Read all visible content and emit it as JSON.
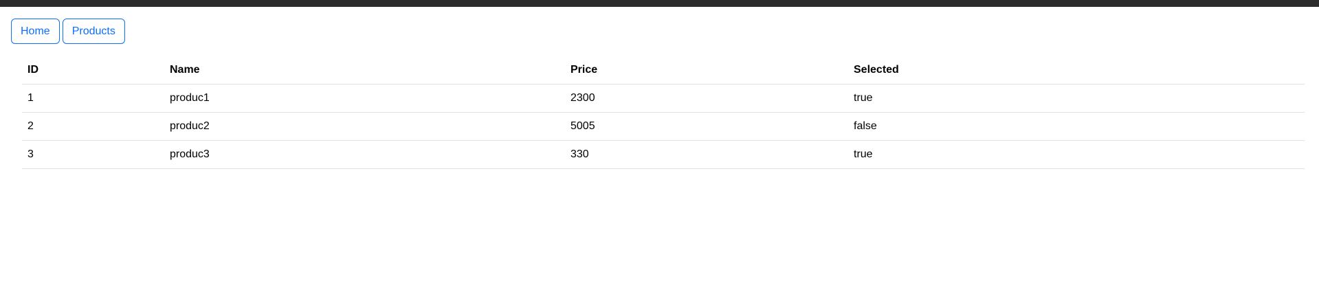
{
  "nav": {
    "home": "Home",
    "products": "Products"
  },
  "table": {
    "headers": [
      "ID",
      "Name",
      "Price",
      "Selected"
    ],
    "rows": [
      [
        "1",
        "produc1",
        "2300",
        "true"
      ],
      [
        "2",
        "produc2",
        "5005",
        "false"
      ],
      [
        "3",
        "produc3",
        "330",
        "true"
      ]
    ]
  }
}
